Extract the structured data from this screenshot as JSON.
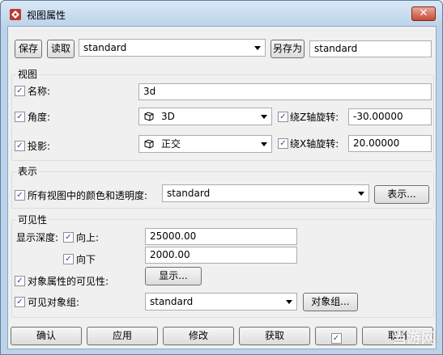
{
  "window": {
    "title": "视图属性",
    "close_glyph": "✕"
  },
  "top": {
    "save_label": "保存",
    "load_label": "读取",
    "preset_value": "standard",
    "save_as_label": "另存为",
    "save_as_value": "standard"
  },
  "view": {
    "title": "视图",
    "name_label": "名称:",
    "name_value": "3d",
    "angle_label": "角度:",
    "angle_value": "3D",
    "rotz_label": "绕Z轴旋转:",
    "rotz_value": "-30.00000",
    "projection_label": "投影:",
    "projection_value": "正交",
    "rotx_label": "绕X轴旋转:",
    "rotx_value": "20.00000"
  },
  "display": {
    "title": "表示",
    "colors_label": "所有视图中的颜色和透明度:",
    "colors_value": "standard",
    "display_button": "表示..."
  },
  "visibility": {
    "title": "可见性",
    "depth_label": "显示深度:",
    "up_label": "向上:",
    "up_value": "25000.00",
    "down_label": "向下",
    "down_value": "2000.00",
    "object_props_label": "对象属性的可见性:",
    "show_button": "显示...",
    "visible_groups_label": "可见对象组:",
    "groups_value": "standard",
    "groups_button": "对象组..."
  },
  "bottom": {
    "ok": "确认",
    "apply": "应用",
    "modify": "修改",
    "get": "获取",
    "cancel": "取消"
  },
  "watermark": "当游网",
  "colors": {
    "accent": "#2a4d9b",
    "window_frame": "#bcd3ea",
    "close": "#c74a35"
  }
}
